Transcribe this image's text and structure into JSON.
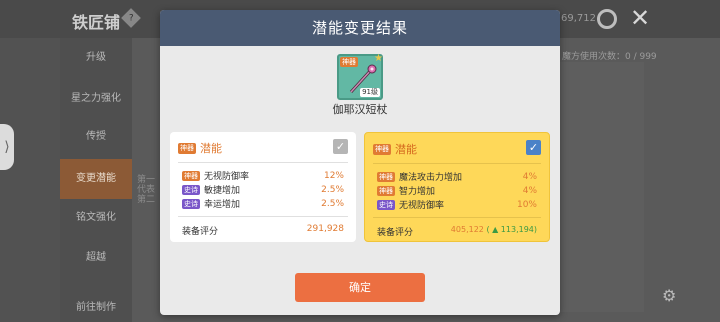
{
  "background": {
    "title": "铁匠铺",
    "help_icon": "?",
    "right_number": "69,712",
    "usage_text": "魔方使用次数：0 / 999",
    "menu": [
      "升级",
      "星之力强化",
      "传授",
      "变更潜能",
      "铭文强化",
      "超越",
      "前往制作"
    ],
    "active_menu_index": 3,
    "content_snippet": [
      "第一",
      "代表",
      "第二"
    ]
  },
  "modal": {
    "title": "潜能变更结果",
    "item": {
      "name": "伽耶汉短杖",
      "tag": "神器",
      "level": "91级",
      "icon": "staff-icon"
    },
    "old_potential": {
      "grade": "神器",
      "title": "潜能",
      "selected": false,
      "stats": [
        {
          "badge": "神器",
          "badge_color": "#e07b33",
          "name": "无视防御率",
          "value": "12%"
        },
        {
          "badge": "史诗",
          "badge_color": "#7a57c9",
          "name": "敏捷增加",
          "value": "2.5%"
        },
        {
          "badge": "史诗",
          "badge_color": "#7a57c9",
          "name": "幸运增加",
          "value": "2.5%"
        }
      ],
      "score_label": "装备评分",
      "score_value": "291,928"
    },
    "new_potential": {
      "grade": "神器",
      "title": "潜能",
      "selected": true,
      "stats": [
        {
          "badge": "神器",
          "badge_color": "#e07b33",
          "name": "魔法攻击力增加",
          "value": "4%"
        },
        {
          "badge": "神器",
          "badge_color": "#e07b33",
          "name": "智力增加",
          "value": "4%"
        },
        {
          "badge": "史诗",
          "badge_color": "#7a57c9",
          "name": "无视防御率",
          "value": "10%"
        }
      ],
      "score_label": "装备评分",
      "score_value": "405,122",
      "score_delta": "( ▲ 113,194)"
    },
    "confirm_label": "确定"
  }
}
